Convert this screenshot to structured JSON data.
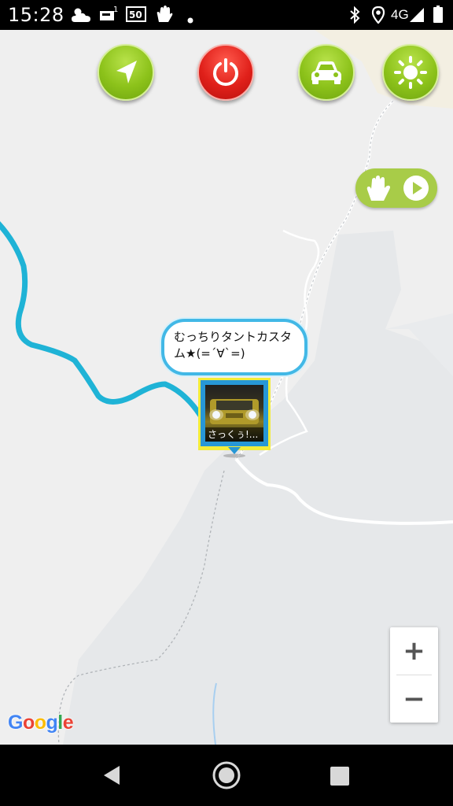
{
  "status_bar": {
    "time": "15:28",
    "network": "4G",
    "notification_icons": [
      "weather-icon",
      "sim-1-icon",
      "app-50-icon",
      "gesture-app-icon",
      "dot-icon"
    ],
    "system_icons": [
      "bluetooth-icon",
      "location-icon",
      "signal-icon",
      "battery-icon"
    ]
  },
  "toolbar": {
    "buttons": [
      "navigate-button",
      "power-button",
      "car-button",
      "brightness-button"
    ],
    "colors": {
      "green": "#8cc21a",
      "red": "#e0201a"
    }
  },
  "gesture_control": {
    "icons": [
      "hand-icon",
      "play-icon"
    ]
  },
  "map": {
    "route_color": "#1fb3d6",
    "bubble": {
      "line1": "むっちりタントカスタ",
      "line2": "ム★(=´∀`=)"
    },
    "marker": {
      "caption": "さっくぅ!..."
    },
    "logo": {
      "letters": [
        "G",
        "o",
        "o",
        "g",
        "l",
        "e"
      ]
    }
  },
  "zoom": {
    "in_label": "+",
    "out_label": "−"
  },
  "nav_bar": {
    "buttons": [
      "back-button",
      "home-button",
      "recents-button"
    ]
  }
}
